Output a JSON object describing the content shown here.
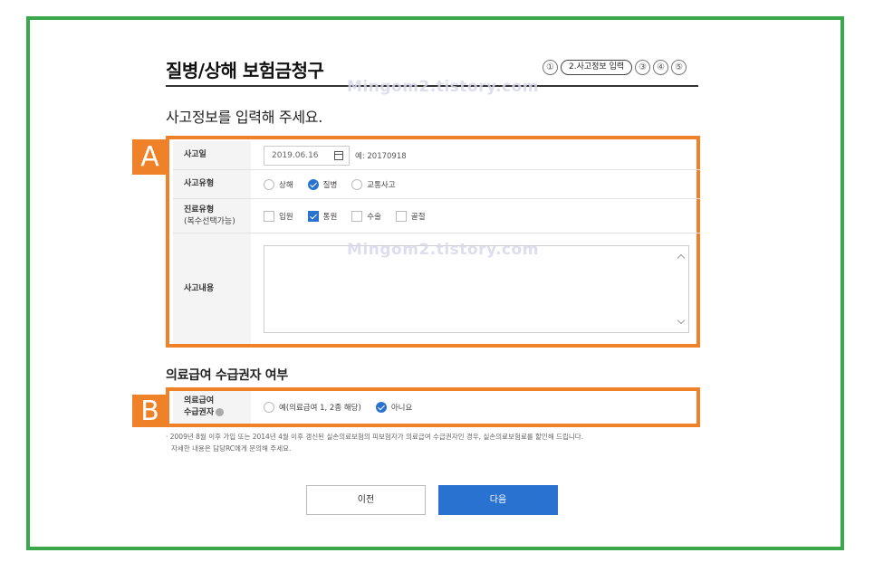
{
  "header": {
    "title": "질병/상해 보험금청구",
    "steps": [
      "①",
      "2.사고정보 입력",
      "③",
      "④",
      "⑤"
    ]
  },
  "watermark": "Mingom2.tistory.com",
  "subtitle": "사고정보를 입력해 주세요.",
  "section_a": {
    "tag": "A",
    "accident_date": {
      "label": "사고일",
      "value": "2019.06.16",
      "example": "예: 20170918"
    },
    "accident_type": {
      "label": "사고유형",
      "options": [
        "상해",
        "질병",
        "교통사고"
      ],
      "selected": "질병"
    },
    "treatment_type": {
      "label": "진료유형",
      "label_sub": "(복수선택가능)",
      "options": [
        "입원",
        "통원",
        "수술",
        "골절"
      ],
      "checked": [
        "통원"
      ]
    },
    "accident_content": {
      "label": "사고내용",
      "value": ""
    }
  },
  "section_b": {
    "heading": "의료급여 수급권자 여부",
    "tag": "B",
    "label_line1": "의료급여",
    "label_line2": "수급권자",
    "options": [
      "예(의료급여 1, 2종 해당)",
      "아니요"
    ],
    "selected": "아니요"
  },
  "note": {
    "line1": "· 2009년 8월 이후 가입 또는 2014년 4월 이후 갱신된 실손의료보험의 피보험자가 의료급여 수급권자인 경우, 실손의료보험료를 할인해 드립니다.",
    "line2": "자세한 내용은 담당RC에게 문의해 주세요."
  },
  "buttons": {
    "prev": "이전",
    "next": "다음"
  },
  "colors": {
    "frame": "#3aa84a",
    "highlight": "#ef8128",
    "primary": "#2a72d0"
  }
}
